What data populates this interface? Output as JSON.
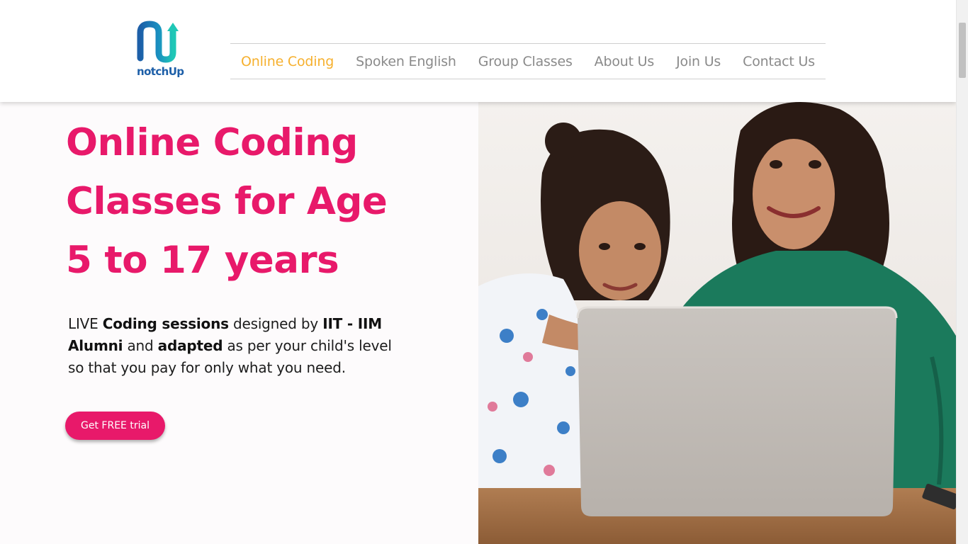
{
  "brand": {
    "name": "notchUp",
    "colors": {
      "teal": "#1fb8b4",
      "blue": "#1d5fa8"
    }
  },
  "nav": {
    "items": [
      {
        "label": "Online Coding",
        "active": true
      },
      {
        "label": "Spoken English",
        "active": false
      },
      {
        "label": "Group Classes",
        "active": false
      },
      {
        "label": "About Us",
        "active": false
      },
      {
        "label": "Join Us",
        "active": false
      },
      {
        "label": "Contact Us",
        "active": false
      }
    ],
    "active_color": "#f6b02e"
  },
  "hero": {
    "title_lines": [
      "Online Coding",
      "Classes for Age",
      "5 to 17 years"
    ],
    "description": {
      "p1": "LIVE ",
      "b1": "Coding sessions",
      "p2": " designed by ",
      "b2": "IIT - IIM Alumni",
      "p3": " and ",
      "b3": "adapted",
      "p4": " as per your child's level so that you pay for only what you need."
    },
    "cta_label": "Get FREE trial",
    "accent_color": "#e8196a"
  },
  "photo": {
    "icon": "photo-girl-and-mother-laptop"
  }
}
